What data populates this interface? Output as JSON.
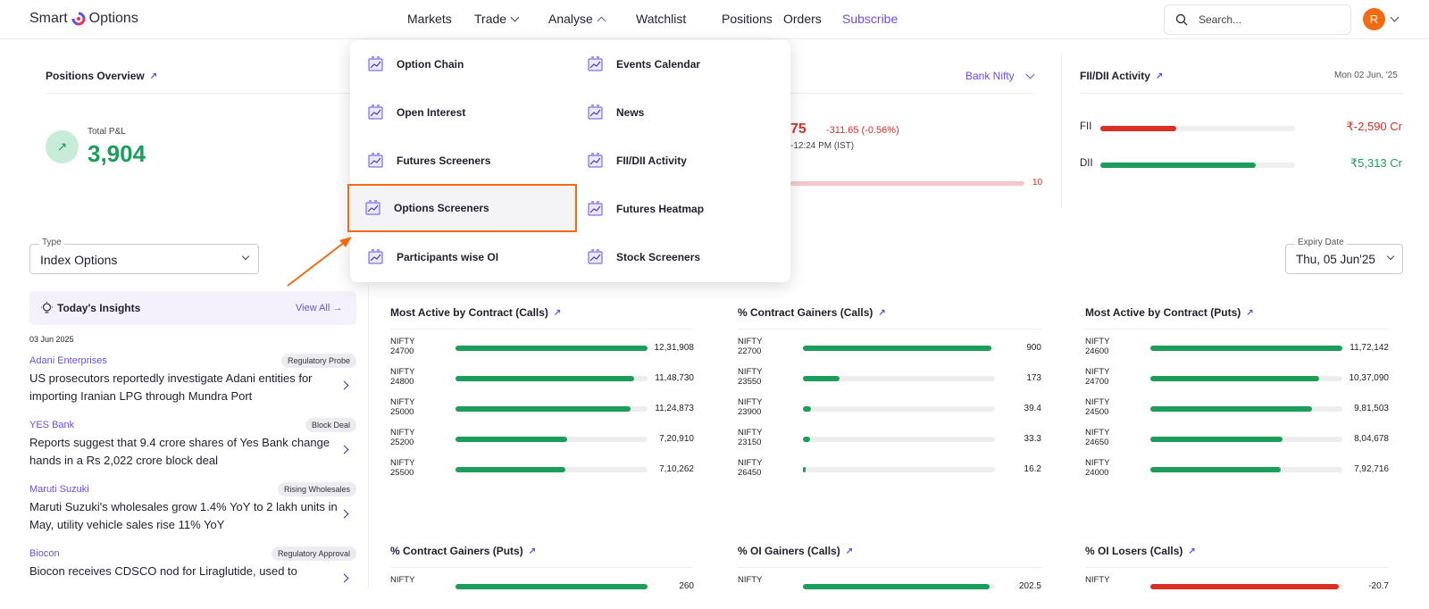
{
  "header": {
    "logo_text_1": "Smart",
    "logo_text_2": "Options",
    "nav": [
      "Markets",
      "Trade",
      "Analyse",
      "Watchlist",
      "Positions",
      "Orders",
      "Subscribe"
    ],
    "search_placeholder": "Search...",
    "avatar_initial": "R"
  },
  "positions": {
    "title": "Positions Overview",
    "pnl_label": "Total P&L",
    "pnl_value": "3,904"
  },
  "index_widget": {
    "selector": "Bank Nifty",
    "price_partial": "75",
    "change": "-311.65 (-0.56%)",
    "time": "-12:24 PM (IST)",
    "range_end": "10"
  },
  "fii": {
    "title": "FII/DII Activity",
    "date": "Mon 02 Jun, '25",
    "rows": [
      {
        "label": "FII",
        "value": "₹-2,590 Cr",
        "fill": 0.39,
        "color": "#d93025"
      },
      {
        "label": "DII",
        "value": "₹5,313 Cr",
        "fill": 0.8,
        "color": "#1c9e5a"
      }
    ]
  },
  "type_select": {
    "label": "Type",
    "value": "Index Options"
  },
  "expiry_select": {
    "label": "Expiry Date",
    "value": "Thu, 05 Jun'25"
  },
  "insights": {
    "title": "Today's Insights",
    "view_all": "View All",
    "date": "03 Jun 2025",
    "items": [
      {
        "company": "Adani Enterprises",
        "tag": "Regulatory Probe",
        "headline": "US prosecutors reportedly investigate Adani entities for importing Iranian LPG through Mundra Port"
      },
      {
        "company": "YES Bank",
        "tag": "Block Deal",
        "headline": "Reports suggest that 9.4 crore shares of Yes Bank change hands in a Rs 2,022 crore block deal"
      },
      {
        "company": "Maruti Suzuki",
        "tag": "Rising Wholesales",
        "headline": "Maruti Suzuki's wholesales grow 1.4% YoY to 2 lakh units in May, utility vehicle sales rise 11% YoY"
      },
      {
        "company": "Biocon",
        "tag": "Regulatory Approval",
        "headline": "Biocon receives CDSCO nod for Liraglutide, used to"
      }
    ]
  },
  "tables": [
    {
      "title": "Most Active by Contract (Calls)",
      "color": "#1c9e5a",
      "rows": [
        {
          "sym": "NIFTY",
          "strike": "24700",
          "value": "12,31,908",
          "fill": 1.0
        },
        {
          "sym": "NIFTY",
          "strike": "24800",
          "value": "11,48,730",
          "fill": 0.93
        },
        {
          "sym": "NIFTY",
          "strike": "25000",
          "value": "11,24,873",
          "fill": 0.91
        },
        {
          "sym": "NIFTY",
          "strike": "25200",
          "value": "7,20,910",
          "fill": 0.58
        },
        {
          "sym": "NIFTY",
          "strike": "25500",
          "value": "7,10,262",
          "fill": 0.57
        }
      ]
    },
    {
      "title": "% Contract Gainers (Calls)",
      "color": "#1c9e5a",
      "rows": [
        {
          "sym": "NIFTY",
          "strike": "22700",
          "value": "900",
          "fill": 0.98
        },
        {
          "sym": "NIFTY",
          "strike": "23550",
          "value": "173",
          "fill": 0.19
        },
        {
          "sym": "NIFTY",
          "strike": "23900",
          "value": "39.4",
          "fill": 0.04
        },
        {
          "sym": "NIFTY",
          "strike": "23150",
          "value": "33.3",
          "fill": 0.035
        },
        {
          "sym": "NIFTY",
          "strike": "26450",
          "value": "16.2",
          "fill": 0.015
        }
      ]
    },
    {
      "title": "Most Active by Contract (Puts)",
      "color": "#1c9e5a",
      "rows": [
        {
          "sym": "NIFTY",
          "strike": "24600",
          "value": "11,72,142",
          "fill": 1.0
        },
        {
          "sym": "NIFTY",
          "strike": "24700",
          "value": "10,37,090",
          "fill": 0.88
        },
        {
          "sym": "NIFTY",
          "strike": "24500",
          "value": "9,81,503",
          "fill": 0.84
        },
        {
          "sym": "NIFTY",
          "strike": "24650",
          "value": "8,04,678",
          "fill": 0.69
        },
        {
          "sym": "NIFTY",
          "strike": "24000",
          "value": "7,92,716",
          "fill": 0.68
        }
      ]
    },
    {
      "title": "% Contract Gainers (Puts)",
      "color": "#1c9e5a",
      "rows": [
        {
          "sym": "NIFTY",
          "strike": "",
          "value": "260",
          "fill": 1.0
        }
      ]
    },
    {
      "title": "% OI Gainers (Calls)",
      "color": "#1c9e5a",
      "rows": [
        {
          "sym": "NIFTY",
          "strike": "",
          "value": "202.5",
          "fill": 0.97
        }
      ]
    },
    {
      "title": "% OI Losers (Calls)",
      "color": "#d93025",
      "rows": [
        {
          "sym": "NIFTY",
          "strike": "",
          "value": "-20.7",
          "fill": 0.98
        }
      ]
    }
  ],
  "menu": {
    "items": [
      {
        "label": "Option Chain",
        "icon": "option-chain-icon"
      },
      {
        "label": "Events Calendar",
        "icon": "calendar-icon"
      },
      {
        "label": "Open Interest",
        "icon": "open-interest-icon"
      },
      {
        "label": "News",
        "icon": "news-icon"
      },
      {
        "label": "Futures Screeners",
        "icon": "futures-screener-icon"
      },
      {
        "label": "FII/DII Activity",
        "icon": "fii-dii-icon"
      },
      {
        "label": "Options Screeners",
        "icon": "options-screener-icon"
      },
      {
        "label": "Futures Heatmap",
        "icon": "heatmap-icon"
      },
      {
        "label": "Participants wise OI",
        "icon": "participants-icon"
      },
      {
        "label": "Stock Screeners",
        "icon": "stock-screener-icon"
      }
    ]
  },
  "colors": {
    "accent": "#6b4de6",
    "green": "#1c9e5a",
    "red": "#d93025",
    "orange": "#f26b12"
  }
}
